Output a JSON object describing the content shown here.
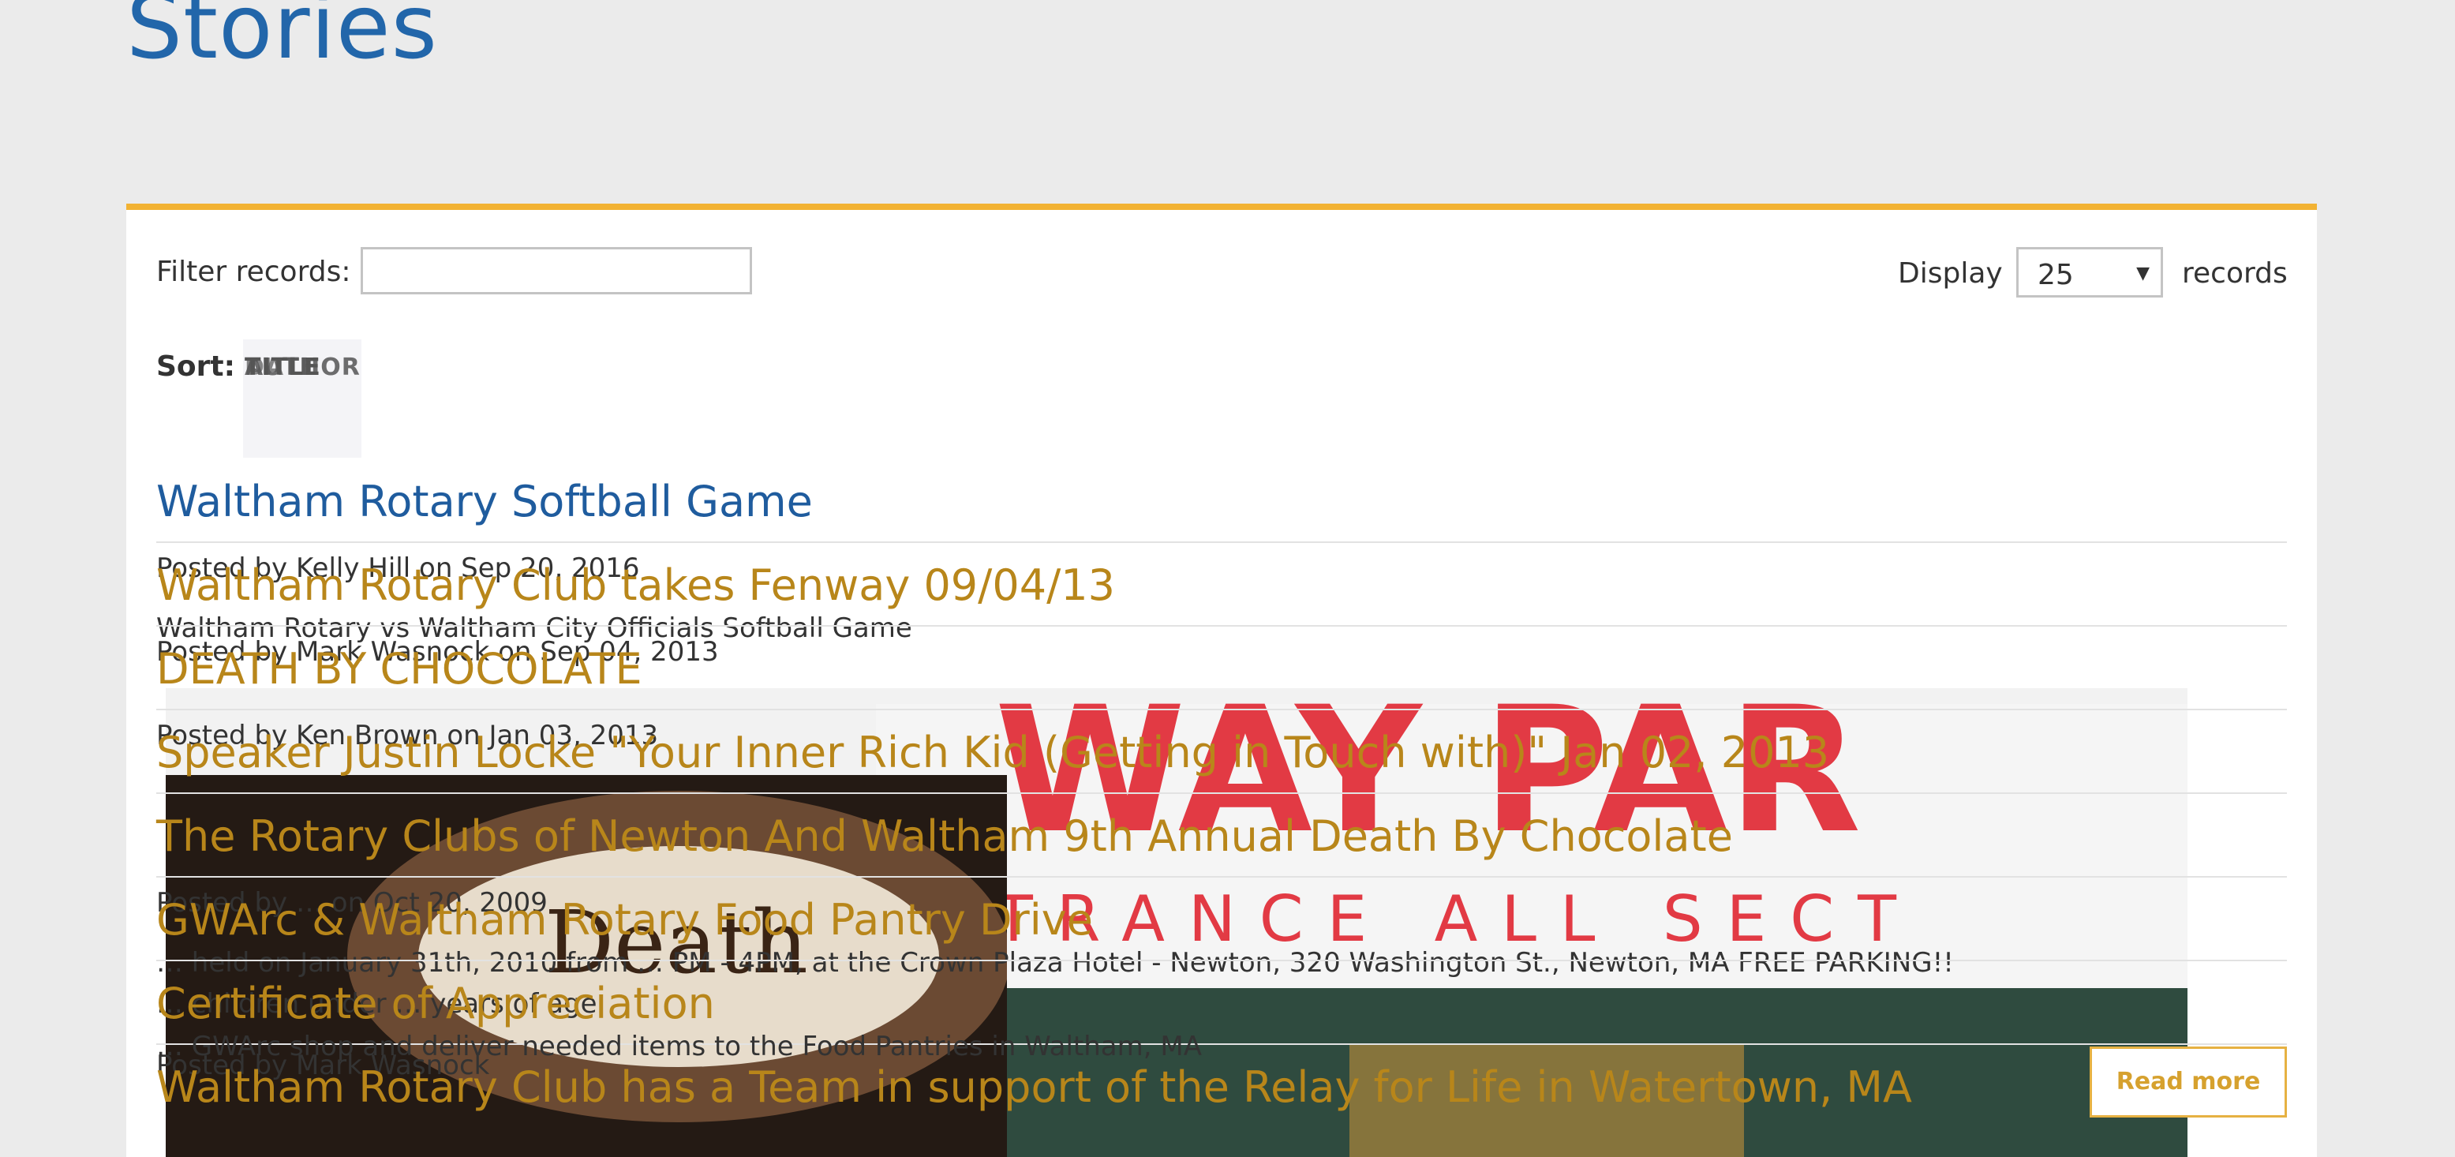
{
  "page": {
    "title": "Stories"
  },
  "filter": {
    "label": "Filter records:",
    "value": "",
    "placeholder": ""
  },
  "display": {
    "label": "Display",
    "selected": "25",
    "suffix": "records"
  },
  "sort": {
    "label": "Sort:",
    "keys": [
      "TITLE",
      "AUTHOR",
      "DATE"
    ],
    "visible_overlap": "TITAUDATE"
  },
  "stories": [
    {
      "title": "Waltham Rotary Softball Game",
      "meta": "Posted by Kelly Hill on Sep 20, 2016",
      "body": "Waltham Rotary vs Waltham City Officials Softball Game"
    },
    {
      "title": "Waltham Rotary Club takes Fenway 09/04/13",
      "meta": "Posted by Mark Wasnock on Sep 04, 2013",
      "body": ""
    },
    {
      "title": "DEATH BY CHOCOLATE",
      "meta": "Posted by Ken Brown on Jan 03, 2013",
      "body": ""
    },
    {
      "title": "Speaker Justin Locke \"Your Inner Rich Kid (Getting in Touch with)\" Jan 02, 2013",
      "meta": "",
      "body": ""
    },
    {
      "title": "The Rotary Clubs of Newton And Waltham 9th Annual Death By Chocolate",
      "meta": "Posted by … on Oct 20, 2009",
      "body": "… held on January 31th, 2010 from … PM - 4PM, at the Crown Plaza Hotel - Newton, 320 Washington St., Newton, MA FREE PARKING!!"
    },
    {
      "title": "GWArc & Waltham Rotary Food Pantry Drive",
      "meta": "",
      "body": "… children under … years of age."
    },
    {
      "title": "Certificate of Appreciation",
      "meta": "",
      "body": "… GWArc shop and deliver needed items to the Food Pantries in Waltham, MA"
    },
    {
      "title": "Waltham Rotary Club has a Team in support of the Relay for Life in Watertown, MA",
      "meta": "Posted by Mark Wasnock",
      "body": ""
    }
  ],
  "read_more": "Read more",
  "colors": {
    "accent": "#f2b233",
    "title_blue": "#1f5c9e",
    "title_gold": "#b8861a"
  }
}
